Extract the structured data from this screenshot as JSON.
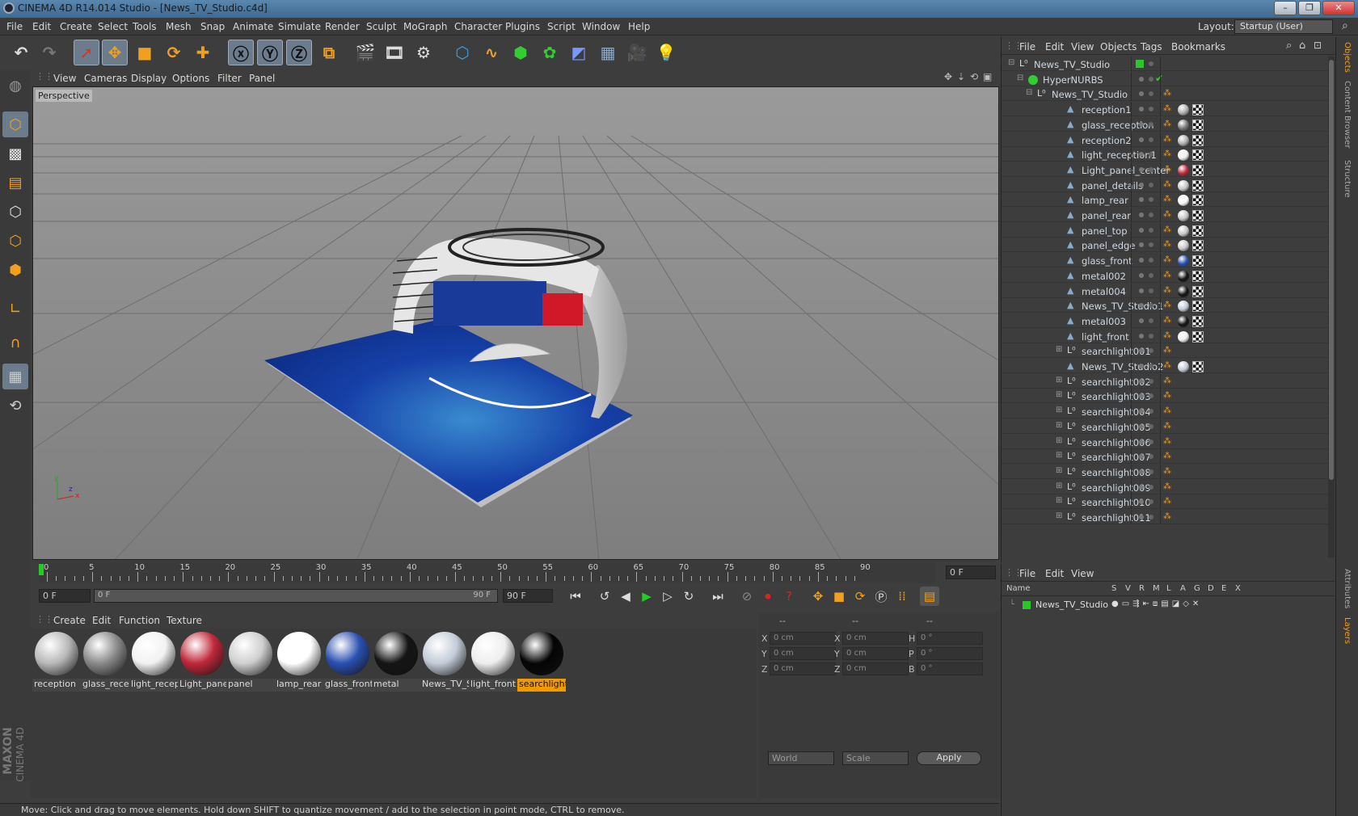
{
  "window": {
    "title": "CINEMA 4D R14.014 Studio - [News_TV_Studio.c4d]"
  },
  "menubar": {
    "items": [
      "File",
      "Edit",
      "Create",
      "Select",
      "Tools",
      "Mesh",
      "Snap",
      "Animate",
      "Simulate",
      "Render",
      "Sculpt",
      "MoGraph",
      "Character",
      "Plugins",
      "Script",
      "Window",
      "Help"
    ],
    "layout_label": "Layout:",
    "layout_value": "Startup (User)"
  },
  "viewport": {
    "menu": [
      "View",
      "Cameras",
      "Display",
      "Options",
      "Filter",
      "Panel"
    ],
    "label": "Perspective",
    "axes": {
      "y": "y",
      "x": "x",
      "z": "z"
    }
  },
  "timeline": {
    "ticks": [
      "0",
      "5",
      "10",
      "15",
      "20",
      "25",
      "30",
      "35",
      "40",
      "45",
      "50",
      "55",
      "60",
      "65",
      "70",
      "75",
      "80",
      "85",
      "90"
    ],
    "current_frame": "0 F"
  },
  "transport": {
    "start": "0 F",
    "range_start": "0 F",
    "range_end": "90 F",
    "end": "90 F"
  },
  "materials": {
    "menu": [
      "Create",
      "Edit",
      "Function",
      "Texture"
    ],
    "items": [
      {
        "label": "reception",
        "color": "#b8b8b8"
      },
      {
        "label": "glass_recep",
        "color": "#8a8a8a"
      },
      {
        "label": "light_recep",
        "color": "#f2f2f2"
      },
      {
        "label": "Light_pane",
        "color": "#c0283a"
      },
      {
        "label": "panel",
        "color": "#cfcfcf"
      },
      {
        "label": "lamp_rear",
        "color": "#ffffff"
      },
      {
        "label": "glass_front",
        "color": "#2a50b0"
      },
      {
        "label": "metal",
        "color": "#151515"
      },
      {
        "label": "News_TV_S",
        "color": "#c4ccd8"
      },
      {
        "label": "light_front",
        "color": "#eeeeee"
      },
      {
        "label": "searchlight",
        "color": "#050505",
        "highlighted": true
      }
    ]
  },
  "coords": {
    "header": [
      "--",
      "--",
      "--"
    ],
    "rows": [
      {
        "a": "X",
        "av": "0 cm",
        "b": "X",
        "bv": "0 cm",
        "c": "H",
        "cv": "0 °"
      },
      {
        "a": "Y",
        "av": "0 cm",
        "b": "Y",
        "bv": "0 cm",
        "c": "P",
        "cv": "0 °"
      },
      {
        "a": "Z",
        "av": "0 cm",
        "b": "Z",
        "bv": "0 cm",
        "c": "B",
        "cv": "0 °"
      }
    ],
    "mode1": "World",
    "mode2": "Scale",
    "apply": "Apply"
  },
  "objects": {
    "menu": [
      "File",
      "Edit",
      "View",
      "Objects",
      "Tags",
      "Bookmarks"
    ],
    "rows": [
      {
        "name": "News_TV_Studio",
        "type": "null",
        "level": 0
      },
      {
        "name": "HyperNURBS",
        "type": "nurbs",
        "level": 1
      },
      {
        "name": "News_TV_Studio",
        "type": "null",
        "level": 2
      },
      {
        "name": "reception1",
        "type": "poly",
        "level": 3,
        "mat": "#b0b0b0"
      },
      {
        "name": "glass_reception",
        "type": "poly",
        "level": 3,
        "mat": "#7a7a7a"
      },
      {
        "name": "reception2",
        "type": "poly",
        "level": 3,
        "mat": "#b0b0b0"
      },
      {
        "name": "light_reception1",
        "type": "poly",
        "level": 3,
        "mat": "#f0f0f0"
      },
      {
        "name": "Light_panel_center",
        "type": "poly",
        "level": 3,
        "mat": "#c0283a"
      },
      {
        "name": "panel_details",
        "type": "poly",
        "level": 3,
        "mat": "#c8c8c8"
      },
      {
        "name": "lamp_rear",
        "type": "poly",
        "level": 3,
        "mat": "#ffffff"
      },
      {
        "name": "panel_rear",
        "type": "poly",
        "level": 3,
        "mat": "#c8c8c8"
      },
      {
        "name": "panel_top",
        "type": "poly",
        "level": 3,
        "mat": "#c8c8c8"
      },
      {
        "name": "panel_edge",
        "type": "poly",
        "level": 3,
        "mat": "#c8c8c8"
      },
      {
        "name": "glass_front",
        "type": "poly",
        "level": 3,
        "mat": "#2a50b0"
      },
      {
        "name": "metal002",
        "type": "poly",
        "level": 3,
        "mat": "#151515"
      },
      {
        "name": "metal004",
        "type": "poly",
        "level": 3,
        "mat": "#151515"
      },
      {
        "name": "News_TV_Studio1",
        "type": "poly",
        "level": 3,
        "mat": "#c4ccd8"
      },
      {
        "name": "metal003",
        "type": "poly",
        "level": 3,
        "mat": "#151515"
      },
      {
        "name": "light_front",
        "type": "poly",
        "level": 3,
        "mat": "#eeeeee"
      },
      {
        "name": "searchlight001",
        "type": "null",
        "level": 3
      },
      {
        "name": "News_TV_Studio2",
        "type": "poly",
        "level": 3,
        "mat": "#c4ccd8"
      },
      {
        "name": "searchlight002",
        "type": "null",
        "level": 3
      },
      {
        "name": "searchlight003",
        "type": "null",
        "level": 3
      },
      {
        "name": "searchlight004",
        "type": "null",
        "level": 3
      },
      {
        "name": "searchlight005",
        "type": "null",
        "level": 3
      },
      {
        "name": "searchlight006",
        "type": "null",
        "level": 3
      },
      {
        "name": "searchlight007",
        "type": "null",
        "level": 3
      },
      {
        "name": "searchlight008",
        "type": "null",
        "level": 3
      },
      {
        "name": "searchlight009",
        "type": "null",
        "level": 3
      },
      {
        "name": "searchlight010",
        "type": "null",
        "level": 3
      },
      {
        "name": "searchlight011",
        "type": "null",
        "level": 3
      }
    ]
  },
  "layers": {
    "menu": [
      "File",
      "Edit",
      "View"
    ],
    "columns": [
      "Name",
      "S",
      "V",
      "R",
      "M",
      "L",
      "A",
      "G",
      "D",
      "E",
      "X"
    ],
    "rows": [
      {
        "name": "News_TV_Studio",
        "color": "#2ec42e"
      }
    ]
  },
  "right_tabs": [
    "Objects",
    "Content Browser",
    "Structure",
    "Attributes",
    "Layers"
  ],
  "status": "Move: Click and drag to move elements. Hold down SHIFT to quantize movement / add to the selection in point mode, CTRL to remove.",
  "brand": {
    "line1": "MAXON",
    "line2": "CINEMA 4D"
  }
}
